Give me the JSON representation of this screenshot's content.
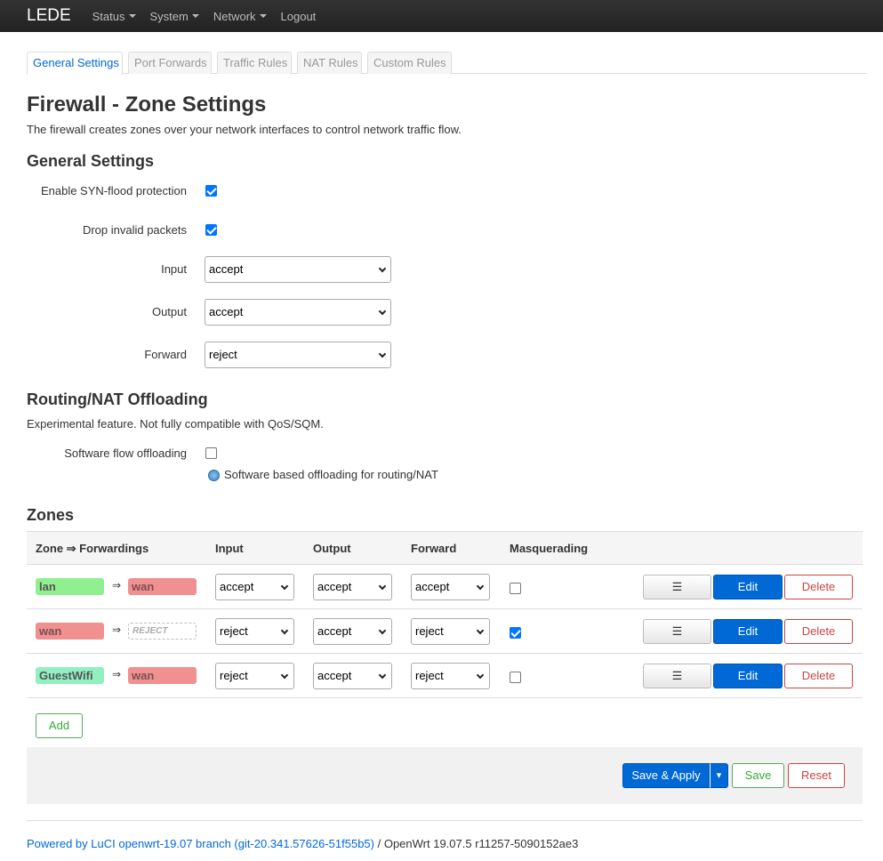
{
  "navbar": {
    "brand": "LEDE",
    "menus": [
      {
        "label": "Status"
      },
      {
        "label": "System"
      },
      {
        "label": "Network"
      },
      {
        "label": "Logout"
      }
    ]
  },
  "tabs": [
    {
      "label": "General Settings",
      "active": true
    },
    {
      "label": "Port Forwards"
    },
    {
      "label": "Traffic Rules"
    },
    {
      "label": "NAT Rules"
    },
    {
      "label": "Custom Rules"
    }
  ],
  "page": {
    "title": "Firewall - Zone Settings",
    "description": "The firewall creates zones over your network interfaces to control network traffic flow."
  },
  "general": {
    "heading": "General Settings",
    "syn_flood_label": "Enable SYN-flood protection",
    "syn_flood_checked": true,
    "drop_invalid_label": "Drop invalid packets",
    "drop_invalid_checked": true,
    "input_label": "Input",
    "input_value": "accept",
    "output_label": "Output",
    "output_value": "accept",
    "forward_label": "Forward",
    "forward_value": "reject"
  },
  "offload": {
    "heading": "Routing/NAT Offloading",
    "description": "Experimental feature. Not fully compatible with QoS/SQM.",
    "software_label": "Software flow offloading",
    "software_checked": false,
    "help_text": "Software based offloading for routing/NAT"
  },
  "zones": {
    "heading": "Zones",
    "columns": {
      "zone": "Zone ⇒ Forwardings",
      "input": "Input",
      "output": "Output",
      "forward": "Forward",
      "masq": "Masquerading"
    },
    "arrow": "⇒",
    "rows": [
      {
        "zone": "lan",
        "dest": "wan",
        "input": "accept",
        "output": "accept",
        "forward": "accept",
        "masq": false
      },
      {
        "zone": "wan",
        "dest": "REJECT",
        "input": "reject",
        "output": "accept",
        "forward": "reject",
        "masq": true
      },
      {
        "zone": "GuestWifi",
        "dest": "wan",
        "input": "reject",
        "output": "accept",
        "forward": "reject",
        "masq": false
      }
    ],
    "menu_label": "☰",
    "edit_label": "Edit",
    "delete_label": "Delete",
    "add_label": "Add"
  },
  "actions": {
    "save_apply": "Save & Apply",
    "dropdown_caret": "▾",
    "save": "Save",
    "reset": "Reset"
  },
  "footer": {
    "link": "Powered by LuCI openwrt-19.07 branch (git-20.341.57626-51f55b5)",
    "separator": " / ",
    "version": "OpenWrt 19.07.5 r11257-5090152ae3"
  },
  "colors": {
    "accent": "#0069d6",
    "zone_lan": "#90f090",
    "zone_wan": "#f09090",
    "zone_guest": "#90f0c0"
  }
}
